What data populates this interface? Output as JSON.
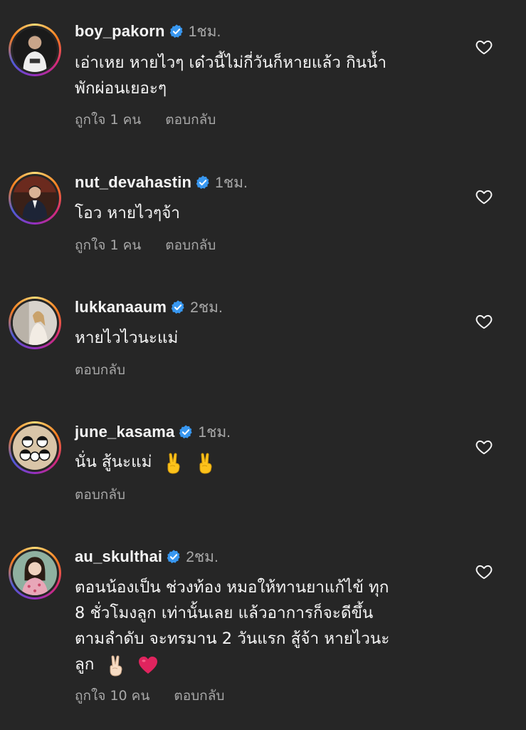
{
  "comments": [
    {
      "username": "boy_pakorn",
      "time": "1ชม.",
      "lines": [
        "เอ่าเหย หายไวๆ เด๋วนี้ไม่กี่วันก็หายแล้ว กินน้ำ",
        "พักผ่อนเยอะๆ"
      ],
      "likes": "ถูกใจ 1 คน",
      "reply": "ตอบกลับ"
    },
    {
      "username": "nut_devahastin",
      "time": "1ชม.",
      "lines": [
        "โอว หายไวๆจ้า"
      ],
      "likes": "ถูกใจ 1 คน",
      "reply": "ตอบกลับ"
    },
    {
      "username": "lukkanaaum",
      "time": "2ชม.",
      "lines": [
        "หายไวไวนะแม่"
      ],
      "reply": "ตอบกลับ"
    },
    {
      "username": "june_kasama",
      "time": "1ชม.",
      "lines": [
        "นั่น สู้นะแม่"
      ],
      "emojis": [
        "victory-hand",
        "victory-hand"
      ],
      "reply": "ตอบกลับ"
    },
    {
      "username": "au_skulthai",
      "time": "2ชม.",
      "lines": [
        "ตอนน้องเป็น ช่วงท้อง หมอให้ทานยาแก้ไข้ ทุก",
        "8 ชั่วโมงลูก เท่านั้นเลย แล้วอาการก็จะดีขึ้น",
        "ตามลำดับ จะทรมาน 2 วันแรก สู้จ้า หายไวนะ",
        "ลูก"
      ],
      "emojis": [
        "victory-hand-light",
        "red-heart"
      ],
      "likes": "ถูกใจ 10 คน",
      "reply": "ตอบกลับ"
    }
  ],
  "colors": {
    "background": "#262626",
    "text": "#f5f5f5",
    "secondary_text": "#a8a8a8",
    "verified_badge": "#3897f0",
    "heart_emoji": "#e0245e"
  },
  "icons": {
    "verified": "verified-badge-icon",
    "like": "heart-outline-icon"
  }
}
